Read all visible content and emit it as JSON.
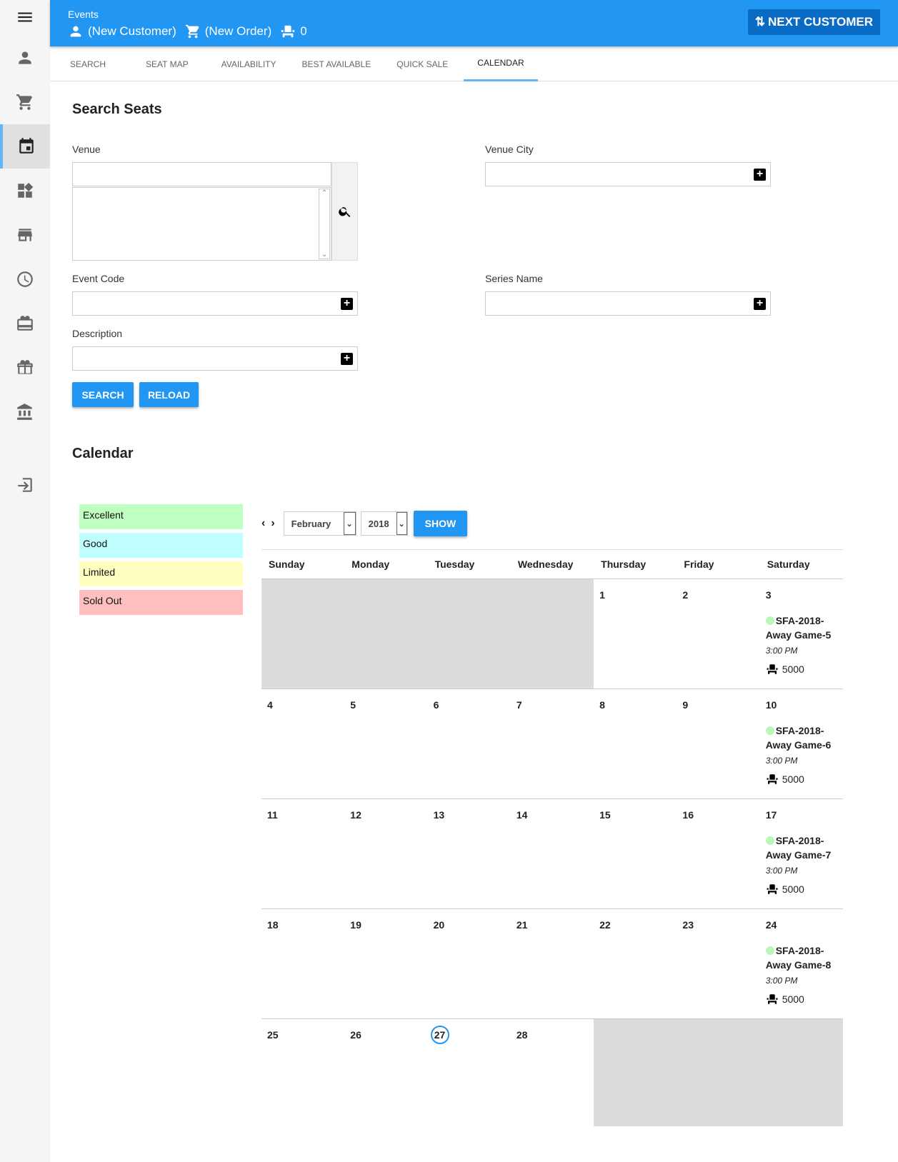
{
  "sidebar": {
    "items": [
      {
        "icon": "menu-icon"
      },
      {
        "icon": "person-icon"
      },
      {
        "icon": "cart-icon"
      },
      {
        "icon": "calendar-icon",
        "active": true
      },
      {
        "icon": "widgets-icon"
      },
      {
        "icon": "store-icon"
      },
      {
        "icon": "clock-icon"
      },
      {
        "icon": "ticket-icon"
      },
      {
        "icon": "gift-icon"
      },
      {
        "icon": "bank-icon"
      },
      {
        "icon": "logout-icon"
      }
    ]
  },
  "header": {
    "title": "Events",
    "customer": "(New Customer)",
    "order": "(New Order)",
    "seats": "0",
    "next_customer": "NEXT CUSTOMER",
    "color": "#2196f3"
  },
  "tabs": [
    "SEARCH",
    "SEAT MAP",
    "AVAILABILITY",
    "BEST AVAILABLE",
    "QUICK SALE",
    "CALENDAR"
  ],
  "active_tab": "CALENDAR",
  "search": {
    "title": "Search Seats",
    "venue_label": "Venue",
    "venue_value": "",
    "venue_city_label": "Venue City",
    "venue_city_value": "",
    "event_code_label": "Event Code",
    "event_code_value": "",
    "series_name_label": "Series Name",
    "series_name_value": "",
    "description_label": "Description",
    "description_value": "",
    "search_button": "SEARCH",
    "reload_button": "RELOAD"
  },
  "calendar": {
    "title": "Calendar",
    "legend": [
      {
        "label": "Excellent",
        "color": "#bfffbf"
      },
      {
        "label": "Good",
        "color": "#bfffff"
      },
      {
        "label": "Limited",
        "color": "#ffffbf"
      },
      {
        "label": "Sold Out",
        "color": "#ffbfbf"
      }
    ],
    "month": "February",
    "year": "2018",
    "show_button": "SHOW",
    "weekdays": [
      "Sunday",
      "Monday",
      "Tuesday",
      "Wednesday",
      "Thursday",
      "Friday",
      "Saturday"
    ],
    "today": "27",
    "weeks": [
      [
        null,
        null,
        null,
        null,
        "1",
        "2",
        "3"
      ],
      [
        "4",
        "5",
        "6",
        "7",
        "8",
        "9",
        "10"
      ],
      [
        "11",
        "12",
        "13",
        "14",
        "15",
        "16",
        "17"
      ],
      [
        "18",
        "19",
        "20",
        "21",
        "22",
        "23",
        "24"
      ],
      [
        "25",
        "26",
        "27",
        "28",
        null,
        null,
        null
      ]
    ],
    "events": {
      "3": {
        "name": "SFA-2018-Away Game-5",
        "time": "3:00 PM",
        "seats": "5000",
        "status": "Excellent"
      },
      "10": {
        "name": "SFA-2018-Away Game-6",
        "time": "3:00 PM",
        "seats": "5000",
        "status": "Excellent"
      },
      "17": {
        "name": "SFA-2018-Away Game-7",
        "time": "3:00 PM",
        "seats": "5000",
        "status": "Excellent"
      },
      "24": {
        "name": "SFA-2018-Away Game-8",
        "time": "3:00 PM",
        "seats": "5000",
        "status": "Excellent"
      }
    }
  }
}
